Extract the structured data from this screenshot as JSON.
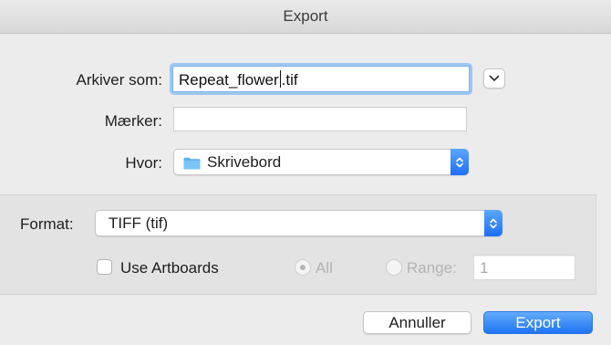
{
  "window": {
    "title": "Export"
  },
  "save_as": {
    "label": "Arkiver som:",
    "value_before_cursor": "Repeat_flower",
    "value_after_cursor": ".tif"
  },
  "tags": {
    "label": "Mærker:",
    "value": ""
  },
  "where": {
    "label": "Hvor:",
    "value": "Skrivebord",
    "icon": "folder-icon"
  },
  "format": {
    "label": "Format:",
    "value": "TIFF (tif)"
  },
  "options": {
    "use_artboards": {
      "label": "Use Artboards",
      "checked": false
    },
    "all": {
      "label": "All",
      "selected": true,
      "enabled": false
    },
    "range": {
      "label": "Range:",
      "value": "1",
      "enabled": false
    }
  },
  "buttons": {
    "cancel": "Annuller",
    "export": "Export"
  },
  "colors": {
    "accent": "#1f73f4",
    "focus_ring": "#9cc7f0",
    "background": "#ececec"
  }
}
